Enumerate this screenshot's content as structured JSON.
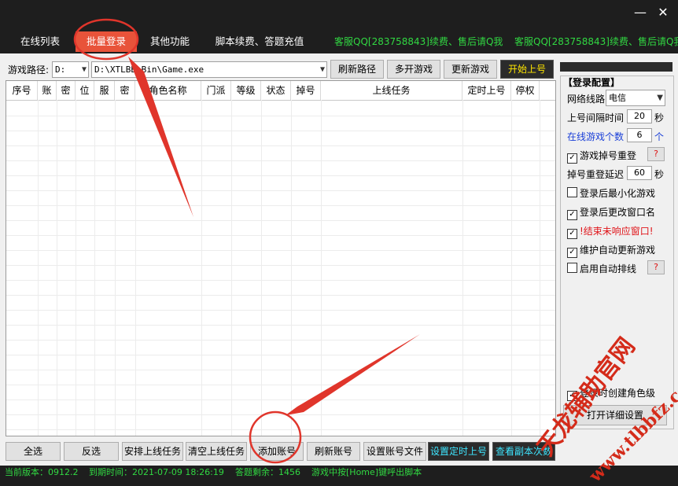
{
  "window": {
    "minimize_glyph": "—",
    "close_glyph": "✕"
  },
  "tabs": [
    {
      "label": "在线列表",
      "active": false
    },
    {
      "label": "批量登录",
      "active": true
    },
    {
      "label": "其他功能",
      "active": false
    },
    {
      "label": "脚本续费、答题充值",
      "active": false
    }
  ],
  "service_notes": [
    "客服QQ[283758843]续费、售后请Q我",
    "客服QQ[283758843]续费、售后请Q我"
  ],
  "toolbar": {
    "path_label": "游戏路径:",
    "drive_value": "D:",
    "path_value": "D:\\XTLBB\\Bin\\Game.exe",
    "refresh_path": "刷新路径",
    "multi_open": "多开游戏",
    "update_game": "更新游戏",
    "start_login": "开始上号"
  },
  "table": {
    "columns": [
      "序号",
      "账",
      "密",
      "位",
      "服",
      "密",
      "角色名称",
      "门派",
      "等级",
      "状态",
      "掉号",
      "上线任务",
      "定时上号",
      "停权"
    ],
    "rows": []
  },
  "config": {
    "title": "【登录配置】",
    "route_label": "网络线路",
    "route_value": "电信",
    "interval_label": "上号间隔时间",
    "interval_value": "20",
    "interval_unit": "秒",
    "online_count_label": "在线游戏个数",
    "online_count_value": "6",
    "online_count_unit": "个",
    "reconnect_label": "游戏掉号重登",
    "reconnect_checked": true,
    "reconnect_delay_label": "掉号重登延迟",
    "reconnect_delay_value": "60",
    "reconnect_delay_unit": "秒",
    "minimize_label": "登录后最小化游戏",
    "minimize_checked": false,
    "rename_label": "登录后更改窗口名",
    "rename_checked": true,
    "kill_label": "!结束未响应窗口!",
    "kill_checked": true,
    "auto_update_label": "维护自动更新游戏",
    "auto_update_checked": true,
    "auto_queue_label": "启用自动排线",
    "auto_queue_checked": false,
    "help_glyph": "?",
    "create_role_label": "登录时创建角色级",
    "create_role_checked": true,
    "open_settings": "打开详细设置"
  },
  "bottom_buttons": {
    "select_all": "全选",
    "invert": "反选",
    "arrange_task": "安排上线任务",
    "clear_task": "清空上线任务",
    "add_account": "添加账号",
    "refresh_account": "刷新账号",
    "set_account_file": "设置账号文件",
    "set_timer": "设置定时上号",
    "view_dungeon": "查看副本次数"
  },
  "status": {
    "version": "当前版本：0912.2",
    "expire": "到期时间：2021-07-09 18:26:19",
    "quiz_left": "答题剩余：1456",
    "hotkey_hint": "游戏中按[Home]键呼出脚本"
  },
  "watermark": {
    "text1": "天龙辅助官网",
    "text2": "www.tlbbfz.com"
  },
  "colors": {
    "accent_tab": "#e8533a",
    "service_green": "#31d842",
    "annotation_red": "#e0352b",
    "start_btn_text": "#ffe600"
  }
}
